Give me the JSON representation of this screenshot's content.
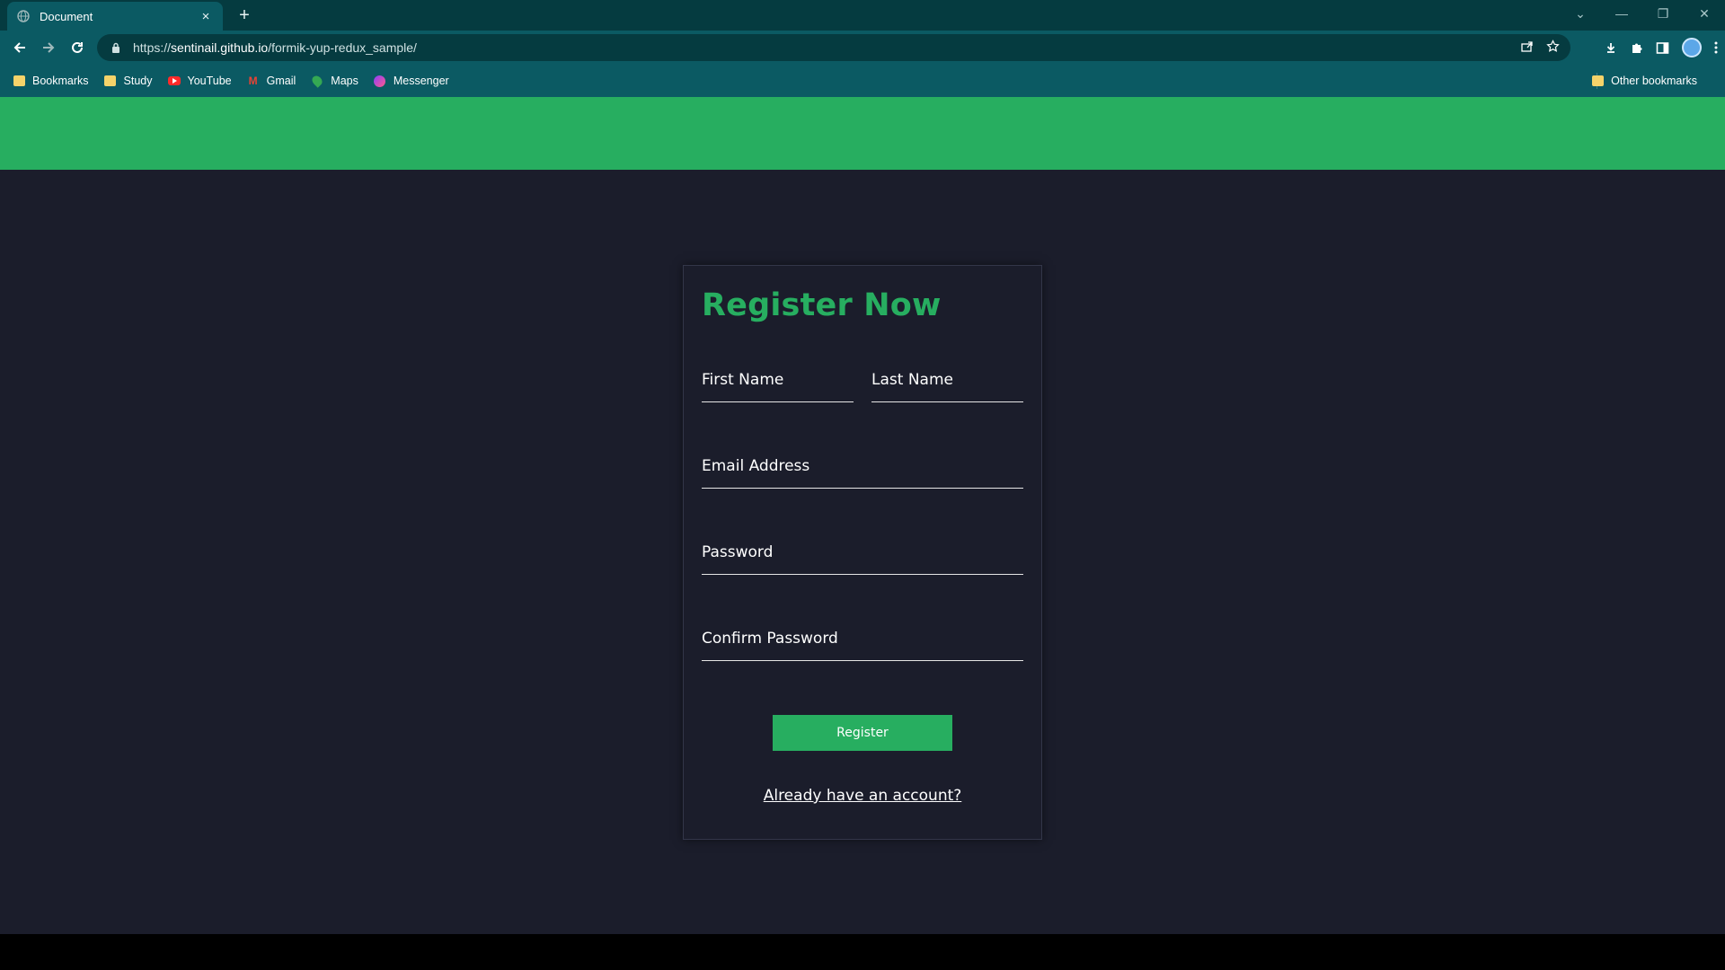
{
  "browser": {
    "tab_title": "Document",
    "tab_close_icon": "×",
    "new_tab_icon": "+",
    "window_controls": [
      "⌄",
      "—",
      "❐",
      "✕"
    ],
    "url_scheme": "https://",
    "url_host": "sentinail.github.io",
    "url_path": "/formik-yup-redux_sample/",
    "bookmarks": [
      {
        "label": "Bookmarks",
        "icon": "folder-icon"
      },
      {
        "label": "Study",
        "icon": "folder-icon"
      },
      {
        "label": "YouTube",
        "icon": "youtube-icon"
      },
      {
        "label": "Gmail",
        "icon": "gmail-icon"
      },
      {
        "label": "Maps",
        "icon": "maps-icon"
      },
      {
        "label": "Messenger",
        "icon": "messenger-icon"
      }
    ],
    "other_bookmarks": "Other bookmarks"
  },
  "form": {
    "title": "Register Now",
    "first_name_label": "First Name",
    "last_name_label": "Last Name",
    "email_label": "Email Address",
    "password_label": "Password",
    "confirm_password_label": "Confirm Password",
    "register_button": "Register",
    "login_link": "Already have an account?"
  },
  "colors": {
    "accent": "#27ae60",
    "page_background": "#1b1d2b",
    "chrome": "#0b5a63"
  }
}
